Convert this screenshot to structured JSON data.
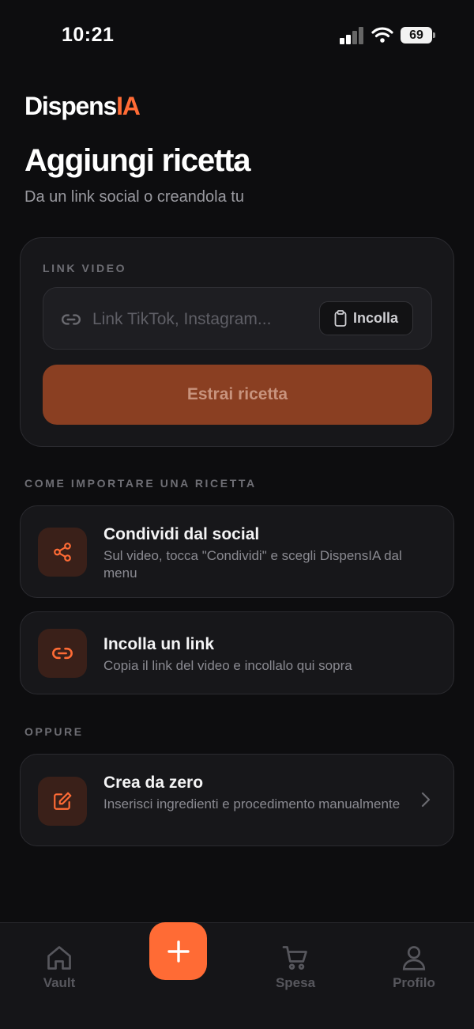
{
  "status_bar": {
    "time": "10:21",
    "battery": "69"
  },
  "brand": {
    "name_main": "Dispens",
    "name_accent": "IA"
  },
  "header": {
    "title": "Aggiungi ricetta",
    "subtitle": "Da un link social o creandola tu"
  },
  "link_card": {
    "label": "LINK VIDEO",
    "placeholder": "Link TikTok, Instagram...",
    "paste_label": "Incolla",
    "extract_label": "Estrai ricetta"
  },
  "import_section": {
    "label": "COME IMPORTARE UNA RICETTA",
    "items": [
      {
        "title": "Condividi dal social",
        "desc": "Sul video, tocca \"Condividi\" e scegli DispensIA dal menu",
        "icon": "share-icon"
      },
      {
        "title": "Incolla un link",
        "desc": "Copia il link del video e incollalo qui sopra",
        "icon": "link-icon"
      }
    ]
  },
  "or_section": {
    "label": "OPPURE",
    "create": {
      "title": "Crea da zero",
      "desc": "Inserisci ingredienti e procedimento manualmente",
      "icon": "edit-icon"
    }
  },
  "tab_bar": {
    "tabs": [
      {
        "label": "Vault",
        "icon": "home-icon"
      },
      {
        "label": "Spesa",
        "icon": "cart-icon"
      },
      {
        "label": "Profilo",
        "icon": "user-icon"
      }
    ],
    "add_icon": "plus-icon"
  },
  "colors": {
    "accent": "#ff6b35",
    "background": "#0d0d0f",
    "card": "#17171a"
  }
}
